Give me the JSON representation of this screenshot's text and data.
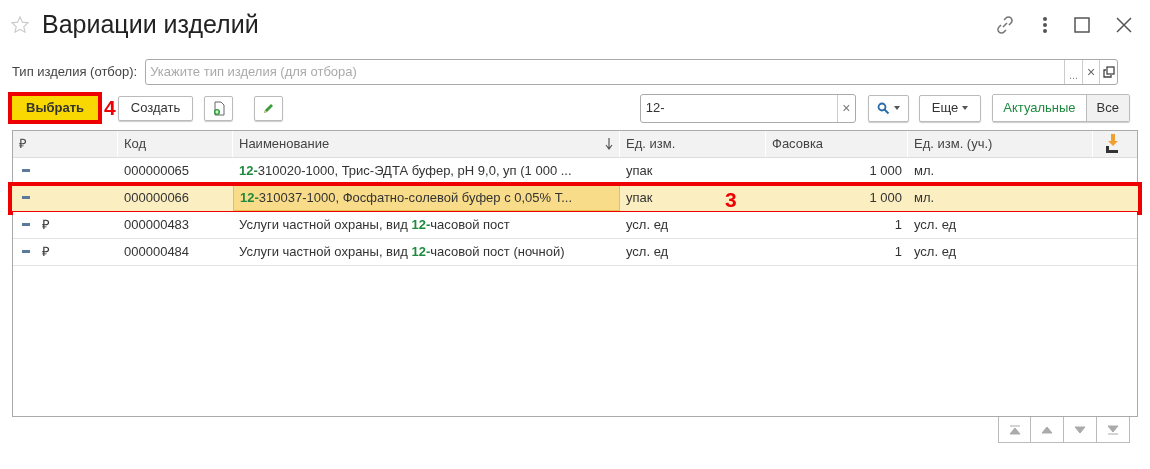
{
  "window": {
    "title": "Вариации изделий"
  },
  "filter": {
    "label": "Тип изделия (отбор):",
    "placeholder": "Укажите тип изделия (для отбора)",
    "select_button": "...",
    "clear_button": "×"
  },
  "toolbar": {
    "select_button": {
      "label": "Выбрать",
      "annotation": "4"
    },
    "create_button": "Создать",
    "search": {
      "value": "12-",
      "clear": "×"
    },
    "more_button": "Еще",
    "view_tabs": [
      {
        "label": "Актуальные",
        "selected": true
      },
      {
        "label": "Все",
        "selected": false
      }
    ]
  },
  "table": {
    "columns": [
      {
        "label": "₽"
      },
      {
        "label": "Код"
      },
      {
        "label": "Наименование",
        "sorted": true
      },
      {
        "label": "Ед. изм."
      },
      {
        "label": "Фасовка"
      },
      {
        "label": "Ед. изм. (уч.)"
      }
    ],
    "rows": [
      {
        "flag": "",
        "code": "000000065",
        "name": "**12-**310020-1000, Трис-ЭДТА буфер, pH 9,0, уп (1 000 ...",
        "unit": "упак",
        "pack": "1 000",
        "base_unit": "мл.",
        "selected": false
      },
      {
        "flag": "",
        "code": "000000066",
        "name": "**12-**310037-1000, Фосфатно-солевой буфер с 0,05% Т...",
        "unit": "упак",
        "pack": "1 000",
        "base_unit": "мл.",
        "selected": true,
        "annotation": "3"
      },
      {
        "flag": "₽",
        "code": "000000483",
        "name": "Услуги частной охраны, вид **12-**часовой пост",
        "unit": "усл. ед",
        "pack": "1",
        "base_unit": "усл. ед",
        "selected": false
      },
      {
        "flag": "₽",
        "code": "000000484",
        "name": "Услуги частной охраны, вид **12-**часовой пост (ночной)",
        "unit": "усл. ед",
        "pack": "1",
        "base_unit": "усл. ед",
        "selected": false
      }
    ]
  }
}
